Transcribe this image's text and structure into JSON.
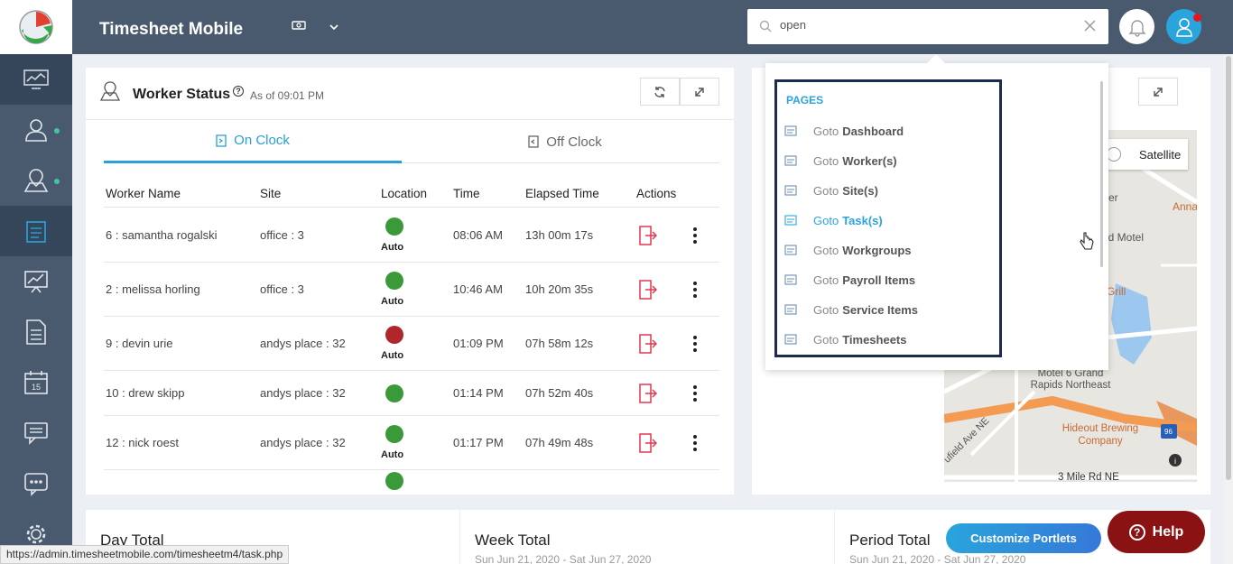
{
  "header": {
    "app_title": "Timesheet Mobile",
    "currency_symbol": "💵",
    "search": {
      "value": "open",
      "placeholder": ""
    }
  },
  "worker_status": {
    "title": "Worker Status",
    "as_of": "As of 09:01 PM",
    "tabs": [
      {
        "label": "On Clock",
        "active": true
      },
      {
        "label": "Off Clock",
        "active": false
      }
    ],
    "columns": [
      "Worker Name",
      "Site",
      "Location",
      "Time",
      "Elapsed Time",
      "Actions"
    ],
    "rows": [
      {
        "name": "6 : samantha rogalski",
        "site": "office : 3",
        "location_color": "green",
        "location_label": "Auto",
        "time": "08:06 AM",
        "elapsed": "13h 00m 17s"
      },
      {
        "name": "2 : melissa horling",
        "site": "office : 3",
        "location_color": "green",
        "location_label": "Auto",
        "time": "10:46 AM",
        "elapsed": "10h 20m 35s"
      },
      {
        "name": "9 : devin urie",
        "site": "andys place : 32",
        "location_color": "red",
        "location_label": "Auto",
        "time": "01:09 PM",
        "elapsed": "07h 58m 12s"
      },
      {
        "name": "10 : drew skipp",
        "site": "andys place : 32",
        "location_color": "green",
        "location_label": "",
        "time": "01:14 PM",
        "elapsed": "07h 52m 40s"
      },
      {
        "name": "12 : nick roest",
        "site": "andys place : 32",
        "location_color": "green",
        "location_label": "Auto",
        "time": "01:17 PM",
        "elapsed": "07h 49m 48s"
      }
    ]
  },
  "search_dropdown": {
    "heading": "PAGES",
    "items": [
      {
        "prefix": "Goto",
        "target": "Dashboard",
        "highlighted": false
      },
      {
        "prefix": "Goto",
        "target": "Worker(s)",
        "highlighted": false
      },
      {
        "prefix": "Goto",
        "target": "Site(s)",
        "highlighted": false
      },
      {
        "prefix": "Goto",
        "target": "Task(s)",
        "highlighted": true
      },
      {
        "prefix": "Goto",
        "target": "Workgroups",
        "highlighted": false
      },
      {
        "prefix": "Goto",
        "target": "Payroll Items",
        "highlighted": false
      },
      {
        "prefix": "Goto",
        "target": "Service Items",
        "highlighted": false
      },
      {
        "prefix": "Goto",
        "target": "Timesheets",
        "highlighted": false
      }
    ]
  },
  "map": {
    "satellite_label": "Satellite",
    "labels": [
      "Meijer",
      "Anna's H",
      "ld Motel",
      "Grill",
      "Motel 6 Grand Rapids Northeast",
      "Hideout Brewing Company",
      "ufield Ave NE",
      "3 Mile Rd NE",
      "96"
    ]
  },
  "bottom": {
    "cards": [
      {
        "title": "Day Total",
        "date": ""
      },
      {
        "title": "Week Total",
        "date": "Sun Jun 21, 2020 - Sat Jun 27, 2020"
      },
      {
        "title": "Period Total",
        "date": "Sun Jun 21, 2020 - Sat Jun 27, 2020"
      }
    ],
    "customize_label": "Customize Portlets",
    "help_label": "Help"
  },
  "status_url": "https://admin.timesheetmobile.com/timesheetm4/task.php",
  "colors": {
    "sidebar": "#4a5a6e",
    "accent": "#2aa4dc",
    "help": "#8a1212",
    "action_red": "#e0394e"
  }
}
